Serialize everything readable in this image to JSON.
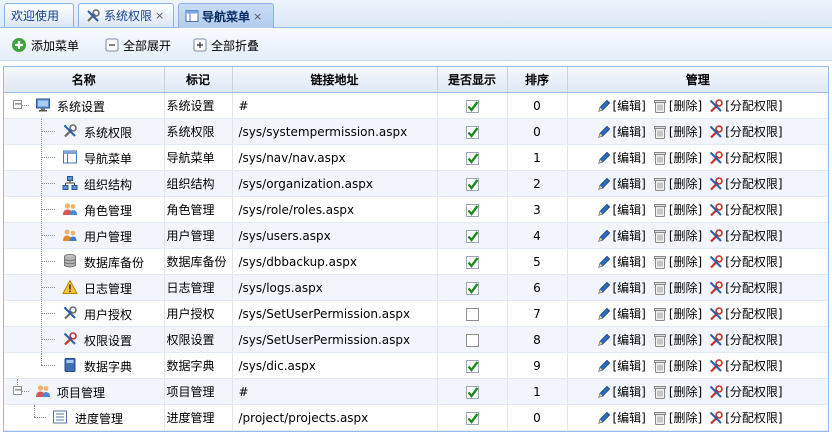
{
  "tabs": [
    {
      "label": "欢迎使用",
      "closable": false,
      "active": false,
      "icon": "none"
    },
    {
      "label": "系统权限",
      "closable": true,
      "active": false,
      "icon": "tools-icon"
    },
    {
      "label": "导航菜单",
      "closable": true,
      "active": true,
      "icon": "window-icon"
    }
  ],
  "close_glyph": "×",
  "toolbar": {
    "add_label": "添加菜单",
    "expand_label": "全部展开",
    "collapse_label": "全部折叠"
  },
  "columns": {
    "name": "名称",
    "label": "标记",
    "url": "链接地址",
    "show": "是否显示",
    "sort": "排序",
    "manage": "管理"
  },
  "actions": {
    "edit": "[编辑]",
    "delete": "[删除]",
    "assign": "[分配权限]"
  },
  "rows": [
    {
      "name": "系统设置",
      "label": "系统设置",
      "url": "#",
      "show": true,
      "sort": "0",
      "level": 0,
      "expander": "−",
      "icon": "monitor-icon",
      "last": false
    },
    {
      "name": "系统权限",
      "label": "系统权限",
      "url": "/sys/systempermission.aspx",
      "show": true,
      "sort": "0",
      "level": 1,
      "icon": "tools-icon",
      "last": false
    },
    {
      "name": "导航菜单",
      "label": "导航菜单",
      "url": "/sys/nav/nav.aspx",
      "show": true,
      "sort": "1",
      "level": 1,
      "icon": "window-icon",
      "last": false
    },
    {
      "name": "组织结构",
      "label": "组织结构",
      "url": "/sys/organization.aspx",
      "show": true,
      "sort": "2",
      "level": 1,
      "icon": "org-chart-icon",
      "last": false
    },
    {
      "name": "角色管理",
      "label": "角色管理",
      "url": "/sys/role/roles.aspx",
      "show": true,
      "sort": "3",
      "level": 1,
      "icon": "users-role-icon",
      "last": false
    },
    {
      "name": "用户管理",
      "label": "用户管理",
      "url": "/sys/users.aspx",
      "show": true,
      "sort": "4",
      "level": 1,
      "icon": "user-manage-icon",
      "last": false
    },
    {
      "name": "数据库备份",
      "label": "数据库备份",
      "url": "/sys/dbbackup.aspx",
      "show": true,
      "sort": "5",
      "level": 1,
      "icon": "database-icon",
      "last": false
    },
    {
      "name": "日志管理",
      "label": "日志管理",
      "url": "/sys/logs.aspx",
      "show": true,
      "sort": "6",
      "level": 1,
      "icon": "warning-icon",
      "last": false
    },
    {
      "name": "用户授权",
      "label": "用户授权",
      "url": "/sys/SetUserPermission.aspx",
      "show": false,
      "sort": "7",
      "level": 1,
      "icon": "tools-icon",
      "last": false
    },
    {
      "name": "权限设置",
      "label": "权限设置",
      "url": "/sys/SetUserPermission.aspx",
      "show": false,
      "sort": "8",
      "level": 1,
      "icon": "permission-icon",
      "last": false
    },
    {
      "name": "数据字典",
      "label": "数据字典",
      "url": "/sys/dic.aspx",
      "show": true,
      "sort": "9",
      "level": 1,
      "icon": "book-icon",
      "last": true
    },
    {
      "name": "项目管理",
      "label": "项目管理",
      "url": "#",
      "show": true,
      "sort": "1",
      "level": 0,
      "expander": "−",
      "icon": "users-role-icon",
      "last": true
    },
    {
      "name": "进度管理",
      "label": "进度管理",
      "url": "/project/projects.aspx",
      "show": true,
      "sort": "0",
      "level": 1,
      "icon": "list-icon",
      "last": true
    }
  ]
}
